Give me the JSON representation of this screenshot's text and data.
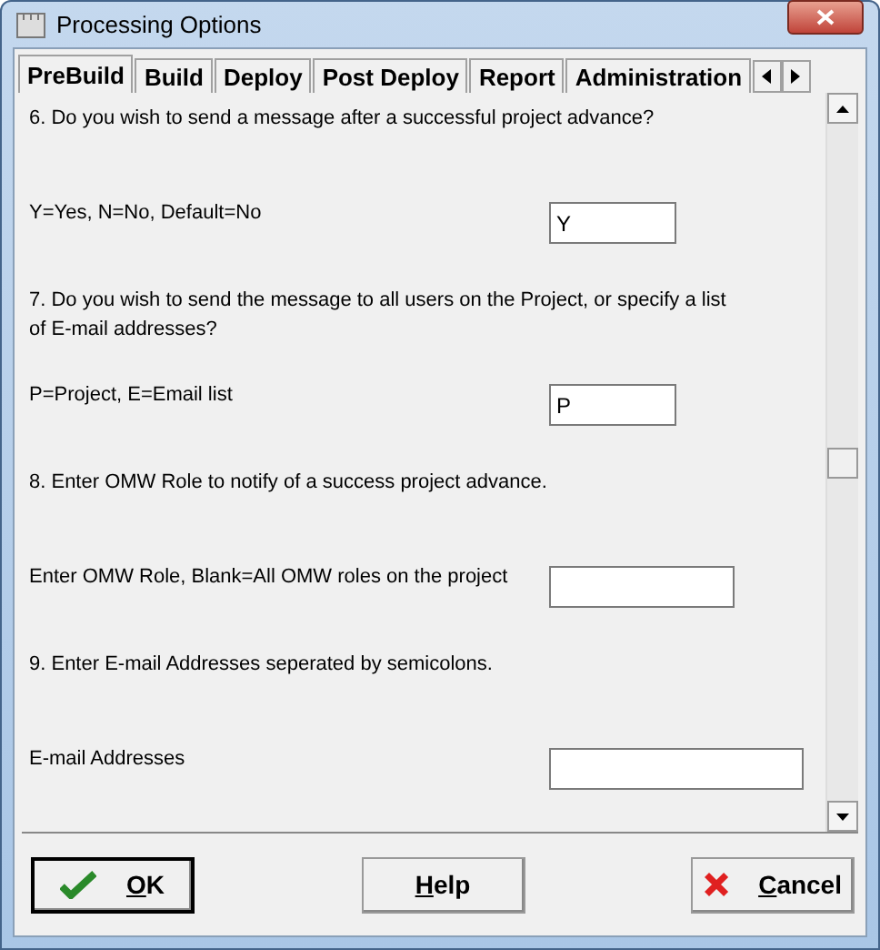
{
  "window": {
    "title": "Processing Options"
  },
  "tabs": [
    {
      "label": "PreBuild",
      "selected": true
    },
    {
      "label": "Build",
      "selected": false
    },
    {
      "label": "Deploy",
      "selected": false
    },
    {
      "label": "Post Deploy",
      "selected": false
    },
    {
      "label": "Report",
      "selected": false
    },
    {
      "label": "Administration",
      "selected": false
    }
  ],
  "options": [
    {
      "question": "6. Do you wish to send a message after a successful project advance?",
      "label": "Y=Yes, N=No, Default=No",
      "value": "Y"
    },
    {
      "question": "7. Do you wish to send the message to all users on the Project, or specify a list of E-mail addresses?",
      "label": "P=Project, E=Email list",
      "value": "P"
    },
    {
      "question": "8. Enter OMW Role to notify of a success project advance.",
      "label": "Enter OMW Role, Blank=All OMW roles on the project"
    },
    {
      "question": "9. Enter E-mail Addresses seperated by semicolons.",
      "label": "E-mail Addresses"
    }
  ],
  "buttons": [
    {
      "kind": "ok",
      "label": "OK"
    },
    {
      "kind": "help",
      "label": "Help"
    },
    {
      "kind": "cancel",
      "label": "Cancel"
    }
  ]
}
